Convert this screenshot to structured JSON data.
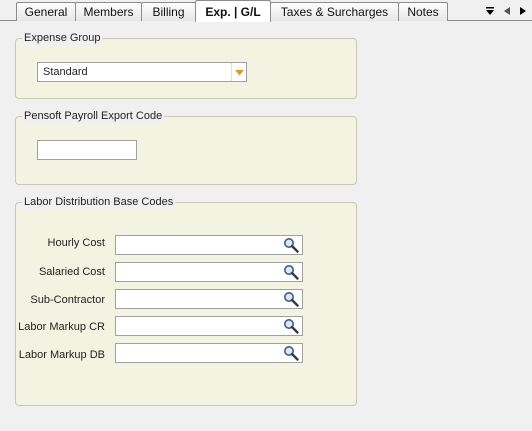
{
  "tabs": [
    {
      "label": "General"
    },
    {
      "label": "Members"
    },
    {
      "label": "Billing"
    },
    {
      "label": "Exp. | G/L"
    },
    {
      "label": "Taxes & Surcharges"
    },
    {
      "label": "Notes"
    }
  ],
  "active_tab": "Exp. | G/L",
  "expense_group": {
    "title": "Expense Group",
    "selected_value": "Standard"
  },
  "pensoft": {
    "title": "Pensoft Payroll Export Code",
    "value": ""
  },
  "labor": {
    "title": "Labor Distribution Base Codes",
    "rows": [
      {
        "label": "Hourly Cost",
        "value": ""
      },
      {
        "label": "Salaried Cost",
        "value": ""
      },
      {
        "label": "Sub-Contractor",
        "value": ""
      },
      {
        "label": "Labor Markup CR",
        "value": ""
      },
      {
        "label": "Labor Markup DB",
        "value": ""
      }
    ]
  },
  "colors": {
    "group_bg": "#f3f3e1",
    "dropdown_arrow": "#d6a21e"
  },
  "icons": [
    "chevron-down-icon",
    "scroll-left-icon",
    "scroll-right-icon",
    "dropdown-arrow-icon",
    "magnifier-icon"
  ]
}
